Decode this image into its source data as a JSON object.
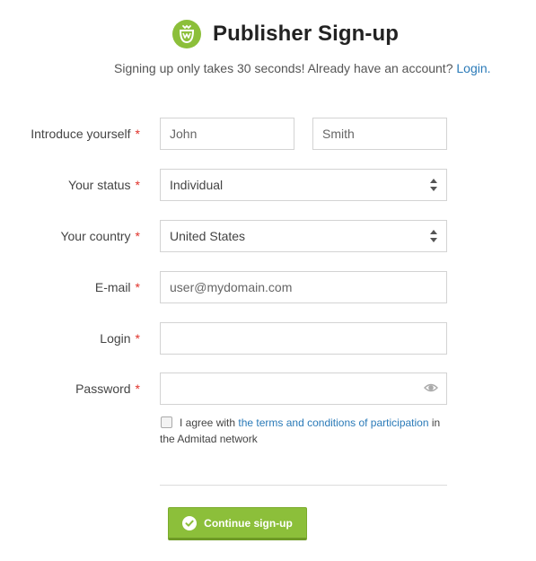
{
  "header": {
    "title": "Publisher Sign-up",
    "subtitle_text": "Signing up only takes 30 seconds! Already have an account?",
    "login_link": "Login.",
    "logo_icon": "admitad-logo-icon",
    "brand_color": "#8cbf3a"
  },
  "form": {
    "required_mark": "*",
    "name": {
      "label": "Introduce yourself",
      "first_placeholder": "John",
      "last_placeholder": "Smith"
    },
    "status": {
      "label": "Your status",
      "value": "Individual"
    },
    "country": {
      "label": "Your country",
      "value": "United States"
    },
    "email": {
      "label": "E-mail",
      "placeholder": "user@mydomain.com"
    },
    "login": {
      "label": "Login",
      "value": ""
    },
    "password": {
      "label": "Password",
      "value": "",
      "toggle_icon": "eye-icon"
    },
    "agreement": {
      "prefix": "I agree with",
      "link_text": "the terms and conditions of participation",
      "suffix": "in the Admitad network",
      "checked": false
    },
    "submit": {
      "label": "Continue sign-up",
      "icon": "check-circle-icon"
    }
  }
}
